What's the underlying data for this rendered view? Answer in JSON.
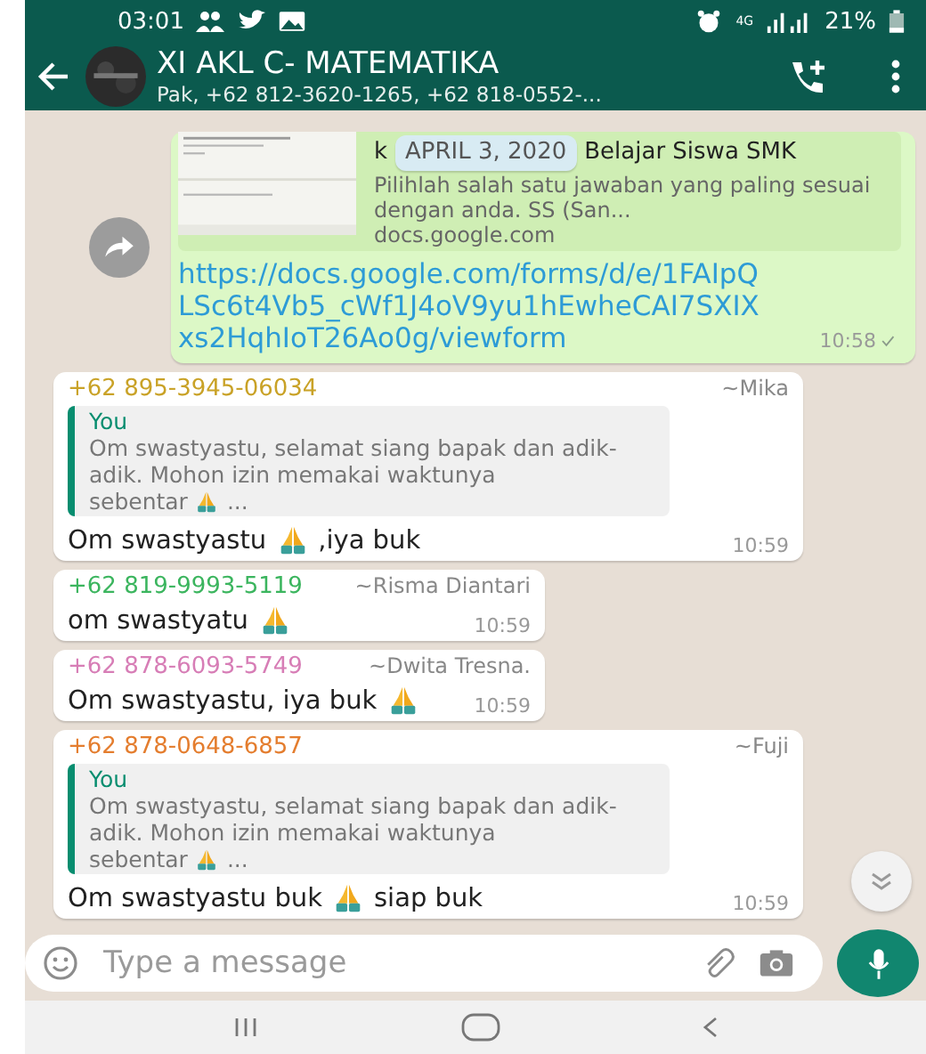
{
  "status_bar": {
    "time": "03:01",
    "network": "4G",
    "battery": "21%"
  },
  "header": {
    "title": "XI AKL C- MATEMATIKA",
    "subtitle": "Pak, +62 812-3620-1265, +62 818-0552-..."
  },
  "shared_link": {
    "title_start": "k",
    "date_chip": "APRIL 3, 2020",
    "title": "Belajar Siswa SMK",
    "description": "Pilihlah salah satu jawaban yang paling sesuai dengan anda. SS (San...",
    "domain": "docs.google.com",
    "url": "https://docs.google.com/forms/d/e/1FAIpQLSc6t4Vb5_cWf1J4oV9yu1hEwheCAI7SXIXxs2HqhIoT26Ao0g/viewform",
    "time": "10:58",
    "delivered": false
  },
  "messages": [
    {
      "phone": "+62 895-3945-06034",
      "name": "~Mika",
      "color": "#c9a227",
      "quote": {
        "author": "You",
        "text": "Om swastyastu, selamat siang bapak dan adik-adik. Mohon izin memakai waktunya",
        "parts": [
          {
            "kind": "text",
            "text": "sebentar"
          },
          {
            "kind": "emoji"
          },
          {
            "kind": "text",
            "text": "..."
          }
        ]
      },
      "parts": [
        {
          "kind": "text",
          "text": "Om swastyastu"
        },
        {
          "kind": "emoji"
        },
        {
          "kind": "text",
          "text": ",iya buk"
        }
      ],
      "time": "10:59"
    },
    {
      "phone": "+62 819-9993-5119",
      "name": "~Risma Diantari",
      "color": "#3bb55e",
      "parts": [
        {
          "kind": "text",
          "text": "om swastyatu"
        },
        {
          "kind": "emoji"
        }
      ],
      "time": "10:59"
    },
    {
      "phone": "+62 878-6093-5749",
      "name": "~Dwita Tresna.",
      "color": "#d77db6",
      "parts": [
        {
          "kind": "text",
          "text": "Om swastyastu, iya buk"
        },
        {
          "kind": "emoji"
        }
      ],
      "time": "10:59"
    },
    {
      "phone": "+62 878-0648-6857",
      "name": "~Fuji",
      "color": "#e47d2e",
      "quote": {
        "author": "You",
        "text": "Om swastyastu, selamat siang bapak dan adik-adik. Mohon izin memakai waktunya",
        "parts": [
          {
            "kind": "text",
            "text": "sebentar"
          },
          {
            "kind": "emoji"
          },
          {
            "kind": "text",
            "text": "..."
          }
        ]
      },
      "parts": [
        {
          "kind": "text",
          "text": "Om swastyastu buk"
        },
        {
          "kind": "emoji"
        },
        {
          "kind": "text",
          "text": "siap buk"
        }
      ],
      "time": "10:59"
    }
  ],
  "composer": {
    "placeholder": "Type a message"
  }
}
